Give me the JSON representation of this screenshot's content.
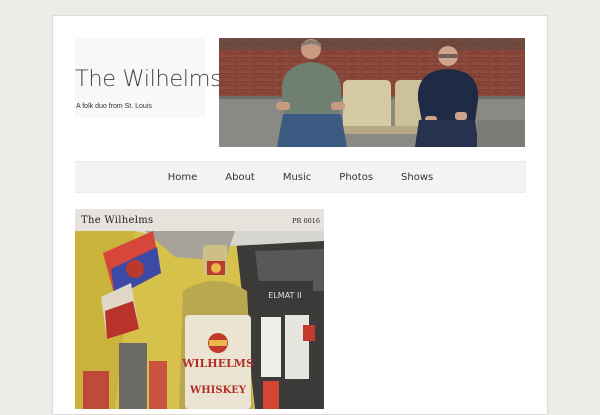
{
  "site": {
    "title": "The Wilhelms",
    "tagline": "A folk duo from St. Louis"
  },
  "nav": {
    "items": [
      {
        "label": "Home",
        "name": "nav-item-home"
      },
      {
        "label": "About",
        "name": "nav-item-about"
      },
      {
        "label": "Music",
        "name": "nav-item-music"
      },
      {
        "label": "Photos",
        "name": "nav-item-photos"
      },
      {
        "label": "Shows",
        "name": "nav-item-shows"
      }
    ]
  },
  "album": {
    "band_name": "The Wilhelms",
    "catalog_number": "PR 0016",
    "bottle_label_line1": "WILHELMS",
    "bottle_label_line2": "WHISKEY",
    "sign_text": "ELMAT II"
  },
  "colors": {
    "page_background": "#eeece8",
    "nav_background": "#f3f3f3",
    "text": "#333333"
  }
}
